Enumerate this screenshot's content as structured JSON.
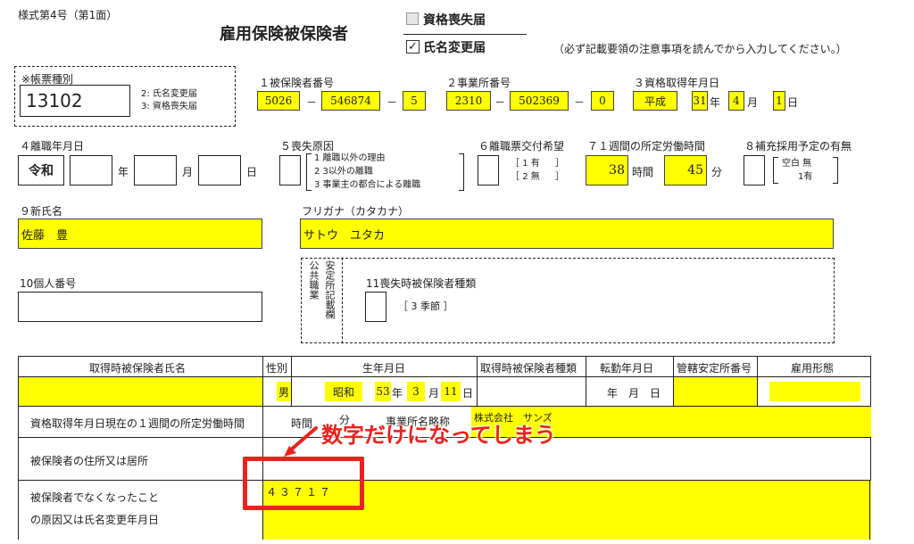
{
  "form": {
    "form_number": "様式第4号（第1面）",
    "title": "雇用保険被保険者",
    "option_loss": "資格喪失届",
    "option_name_change": "氏名変更届",
    "option_loss_checked": false,
    "option_name_change_checked": true,
    "instruction": "（必ず記載要領の注意事項を読んでから入力してください。）"
  },
  "form_type": {
    "label": "※帳票種別",
    "value": "13102",
    "legend_2": "2: 氏名変更届",
    "legend_3": "3: 資格喪失届"
  },
  "insured_number": {
    "label": "１被保険者番号",
    "part1": "5026",
    "part2": "546874",
    "part3": "5",
    "sep": "－"
  },
  "office_number": {
    "label": "２事業所番号",
    "part1": "2310",
    "part2": "502369",
    "part3": "0",
    "sep": "－"
  },
  "acquisition_date": {
    "label": "３資格取得年月日",
    "era": "平成",
    "year": "31",
    "year_unit": "年",
    "month": "4",
    "month_unit": "月",
    "day": "1",
    "day_unit": "日"
  },
  "separation_date": {
    "label": "４離職年月日",
    "era": "令和",
    "year_unit": "年",
    "month_unit": "月",
    "day_unit": "日"
  },
  "loss_cause": {
    "label": "５喪失原因",
    "opt1": "1 離職以外の理由",
    "opt2": "2 3以外の離職",
    "opt3": "3 事業主の都合による離職"
  },
  "separation_slip": {
    "label": "６離職票交付希望",
    "opt1": "1 有",
    "opt2": "2 無"
  },
  "weekly_hours": {
    "label": "７１週間の所定労働時間",
    "hours": "38",
    "hours_unit": "時間",
    "minutes": "45",
    "minutes_unit": "分"
  },
  "replacement": {
    "label": "８補充採用予定の有無",
    "opt1": "空白 無",
    "opt2": "1有"
  },
  "new_name": {
    "label": "９新氏名",
    "value": "佐藤　豊"
  },
  "furigana": {
    "label": "フリガナ（カタカナ）",
    "value": "サトウ　ユタカ"
  },
  "personal_number": {
    "label": "10個人番号"
  },
  "office_use": {
    "vertical_label": "※ 公共職業安定所記載欄",
    "col1": "※",
    "col1b": "公共職業",
    "col2": "安定所記載欄",
    "insured_type_label": "11喪失時被保険者種類",
    "insured_type_note": "［ 3 季節 ］"
  },
  "table": {
    "headers": [
      "取得時被保険者氏名",
      "性別",
      "生年月日",
      "取得時被保険者種類",
      "転勤年月日",
      "管轄安定所番号",
      "雇用形態"
    ],
    "gender": "男",
    "birth_era": "昭和",
    "birth_year": "53",
    "birth_year_unit": "年",
    "birth_month": "3",
    "birth_month_unit": "月",
    "birth_day": "11",
    "birth_day_unit": "日",
    "transfer_date": "年　月　日",
    "weekly_label": "資格取得年月日現在の１週間の所定労働時間",
    "weekly_hours_unit": "時間",
    "weekly_minutes_fragment": "分",
    "office_name_fragment": "事業所名略称",
    "company_name": "株式会社　サンズ",
    "address_label": "被保険者の住所又は居所",
    "reason_label_1": "被保険者でなくなったこと",
    "reason_label_2": "の原因又は氏名変更年月日",
    "reason_value": "４３７１７"
  },
  "annotation": {
    "text": "数字だけになってしまう",
    "color": "#e8231f"
  }
}
